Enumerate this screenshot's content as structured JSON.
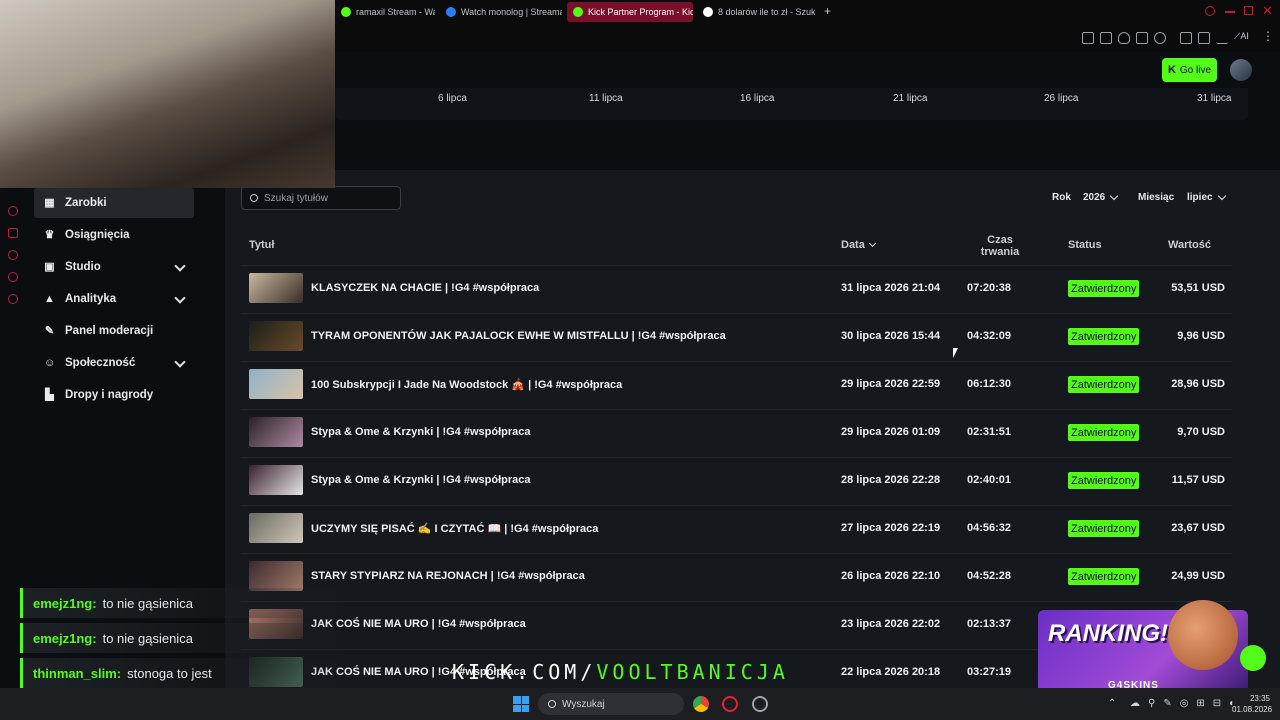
{
  "browser": {
    "tabs": [
      {
        "label": "ramaxil Stream - Watch",
        "color": "#53fc18"
      },
      {
        "label": "Watch monolog | Streamab",
        "color": "#2d7cf6"
      },
      {
        "label": "Kick Partner Program - Kic",
        "color": "#53fc18"
      },
      {
        "label": "8 dolarów ile to zł - Szukaj",
        "color": "#ffffff"
      }
    ],
    "ai_label": "AI"
  },
  "header": {
    "go_live": "Go live"
  },
  "chart_strip": {
    "ticks": [
      "6 lipca",
      "11 lipca",
      "16 lipca",
      "21 lipca",
      "26 lipca",
      "31 lipca"
    ]
  },
  "sidebar": {
    "items": [
      {
        "label": "Zarobki",
        "icon": "chart-icon",
        "glyph": "▦",
        "active": true,
        "chevron": false
      },
      {
        "label": "Osiągnięcia",
        "icon": "trophy-icon",
        "glyph": "♛",
        "active": false,
        "chevron": false
      },
      {
        "label": "Studio",
        "icon": "studio-icon",
        "glyph": "▣",
        "active": false,
        "chevron": true
      },
      {
        "label": "Analityka",
        "icon": "analytics-icon",
        "glyph": "▲",
        "active": false,
        "chevron": true
      },
      {
        "label": "Panel moderacji",
        "icon": "wrench-icon",
        "glyph": "✎",
        "active": false,
        "chevron": false
      },
      {
        "label": "Społeczność",
        "icon": "community-icon",
        "glyph": "☺",
        "active": false,
        "chevron": true
      },
      {
        "label": "Dropy i nagrody",
        "icon": "drops-icon",
        "glyph": "▙",
        "active": false,
        "chevron": false
      }
    ]
  },
  "filters": {
    "search_placeholder": "Szukaj tytułów",
    "year_label": "Rok",
    "year_value": "2026",
    "month_label": "Miesiąc",
    "month_value": "lipiec"
  },
  "table": {
    "headers": {
      "title": "Tytuł",
      "date": "Data",
      "duration_line1": "Czas",
      "duration_line2": "trwania",
      "status": "Status",
      "value": "Wartość"
    },
    "rows": [
      {
        "title": "KLASYCZEK NA CHACIE | !G4 #współpraca",
        "date": "31 lipca 2026 21:04",
        "duration": "07:20:38",
        "status": "Zatwierdzony",
        "value": "53,51 USD"
      },
      {
        "title": "TYRAM OPONENTÓW JAK PAJALOCK EWHE W MISTFALLU | !G4 #współpraca",
        "date": "30 lipca 2026 15:44",
        "duration": "04:32:09",
        "status": "Zatwierdzony",
        "value": "9,96 USD"
      },
      {
        "title": "100 Subskrypcji I Jade Na Woodstock 🎪 | !G4 #współpraca",
        "date": "29 lipca 2026 22:59",
        "duration": "06:12:30",
        "status": "Zatwierdzony",
        "value": "28,96 USD"
      },
      {
        "title": "Stypa & Ome & Krzynki | !G4 #współpraca",
        "date": "29 lipca 2026 01:09",
        "duration": "02:31:51",
        "status": "Zatwierdzony",
        "value": "9,70 USD"
      },
      {
        "title": "Stypa & Ome & Krzynki | !G4 #współpraca",
        "date": "28 lipca 2026 22:28",
        "duration": "02:40:01",
        "status": "Zatwierdzony",
        "value": "11,57 USD"
      },
      {
        "title": "UCZYMY SIĘ PISAĆ ✍️ I CZYTAĆ 📖 | !G4 #współpraca",
        "date": "27 lipca 2026 22:19",
        "duration": "04:56:32",
        "status": "Zatwierdzony",
        "value": "23,67 USD"
      },
      {
        "title": "STARY STYPIARZ NA REJONACH | !G4 #współpraca",
        "date": "26 lipca 2026 22:10",
        "duration": "04:52:28",
        "status": "Zatwierdzony",
        "value": "24,99 USD"
      },
      {
        "title": "JAK COŚ NIE MA URO | !G4 #współpraca",
        "date": "23 lipca 2026 22:02",
        "duration": "02:13:37",
        "status": "",
        "value": ""
      },
      {
        "title": "JAK COŚ NIE MA URO | !G4 #współpraca",
        "date": "22 lipca 2026 20:18",
        "duration": "03:27:19",
        "status": "",
        "value": ""
      }
    ]
  },
  "chat": [
    {
      "user": "emejz1ng:",
      "text": "to nie gąsienica"
    },
    {
      "user": "emejz1ng:",
      "text": "to nie gąsienica"
    },
    {
      "user": "thinman_slim:",
      "text": "stonoga to jest"
    }
  ],
  "overlay": {
    "watermark_prefix": "KICK.COM/",
    "watermark_name": "VOOLTBANICJA",
    "promo_title": "RANKING!",
    "promo_brand": "G4SKINS"
  },
  "taskbar": {
    "search_placeholder": "Wyszukaj",
    "time": "23:35",
    "date": "01.08.2026"
  },
  "colors": {
    "accent": "#53fc18",
    "panel": "#15181c",
    "background": "#0b0e10"
  }
}
